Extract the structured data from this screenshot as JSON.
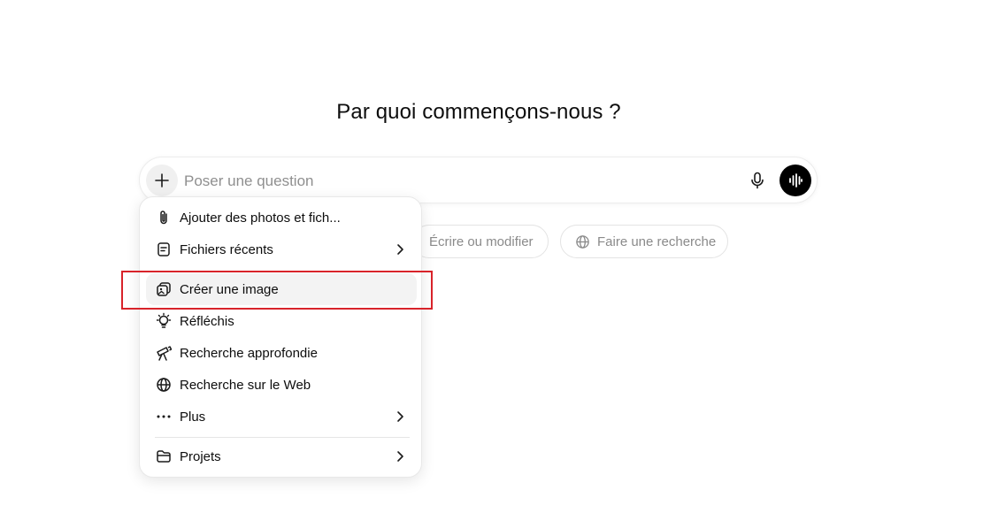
{
  "heading": "Par quoi commençons-nous ?",
  "composer": {
    "placeholder": "Poser une question",
    "plus_icon": "plus-icon",
    "mic_icon": "microphone-icon",
    "voice_icon": "voice-waveform-icon"
  },
  "chips": [
    {
      "label": "Écrire ou modifier",
      "icon": "pen-icon"
    },
    {
      "label": "Faire une recherche",
      "icon": "globe-icon"
    }
  ],
  "menu": {
    "items": [
      {
        "label": "Ajouter des photos et fich...",
        "icon": "paperclip-icon",
        "submenu": false
      },
      {
        "label": "Fichiers récents",
        "icon": "file-icon",
        "submenu": true
      },
      {
        "label": "Créer une image",
        "icon": "image-icon",
        "submenu": false,
        "highlighted": true
      },
      {
        "label": "Réfléchis",
        "icon": "lightbulb-icon",
        "submenu": false
      },
      {
        "label": "Recherche approfondie",
        "icon": "telescope-icon",
        "submenu": false
      },
      {
        "label": "Recherche sur le Web",
        "icon": "globe-icon",
        "submenu": false
      },
      {
        "label": "Plus",
        "icon": "more-dots-icon",
        "submenu": true
      },
      {
        "label": "Projets",
        "icon": "folder-icon",
        "submenu": true
      }
    ]
  },
  "annotation": {
    "color": "#d8232a",
    "target": "Créer une image"
  }
}
